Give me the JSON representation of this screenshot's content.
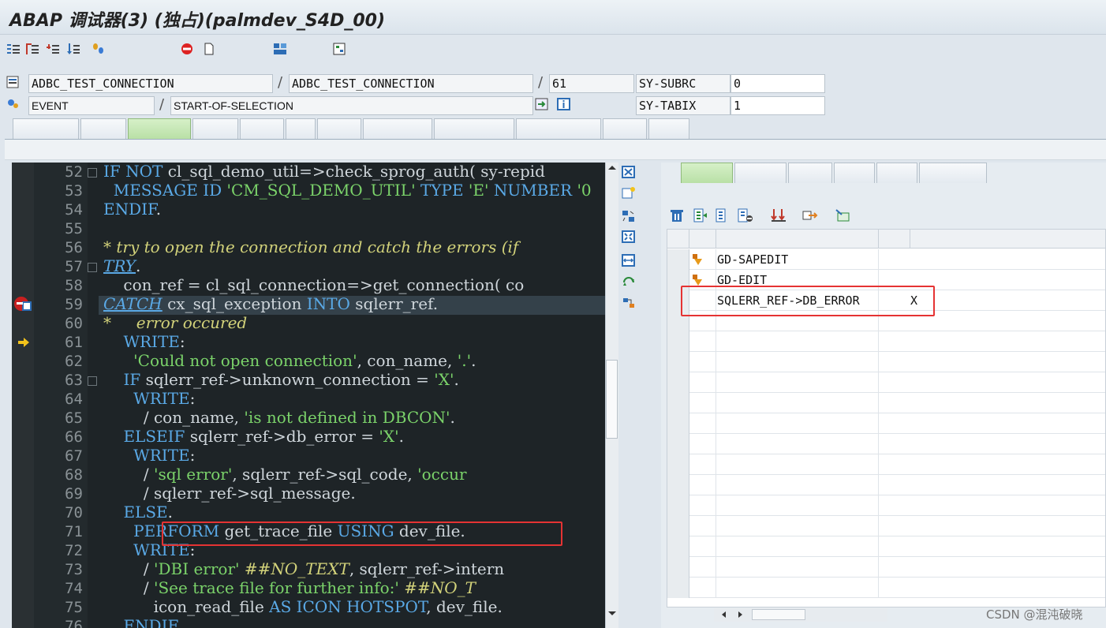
{
  "window": {
    "title": "ABAP 调试器(3) (独占)(palmdev_S4D_00)"
  },
  "toolbar": {
    "step_size_label": "",
    "watchpoint_label": "",
    "layout_label": "",
    "debugger_layer_label": ""
  },
  "context": {
    "program": "ADBC_TEST_CONNECTION",
    "include": "ADBC_TEST_CONNECTION",
    "line": "61",
    "event_type": "EVENT",
    "event_name": "START-OF-SELECTION",
    "sysvars": [
      {
        "name": "SY-SUBRC",
        "value": "0"
      },
      {
        "name": "SY-TABIX",
        "value": "1"
      }
    ]
  },
  "tabs": [
    "",
    "",
    "",
    "",
    "",
    "",
    "",
    "",
    "",
    "",
    "",
    ""
  ],
  "active_tab_index": 2,
  "editor": {
    "lines": [
      {
        "n": "52",
        "html": "<span class=\"kw\">IF NOT</span> cl_sql_demo_util=>check_sprog_auth( sy-repid"
      },
      {
        "n": "53",
        "html": "  <span class=\"kw\">MESSAGE ID</span> <span class=\"str\">'CM_SQL_DEMO_UTIL'</span> <span class=\"kw\">TYPE</span> <span class=\"str\">'E'</span> <span class=\"kw\">NUMBER</span> <span class=\"str\">'0</span>"
      },
      {
        "n": "54",
        "html": "<span class=\"kw\">ENDIF</span>."
      },
      {
        "n": "55",
        "html": ""
      },
      {
        "n": "56",
        "html": "<span class=\"cmt\">* try to open the connection and catch the errors (if</span>"
      },
      {
        "n": "57",
        "html": "<span class=\"kwu\">TRY</span>."
      },
      {
        "n": "58",
        "html": "    con_ref = cl_sql_connection=>get_connection( co"
      },
      {
        "n": "59",
        "html": "<span class=\"kwu\">CATCH</span> cx_sql_exception <span class=\"kw\">INTO</span> sqlerr_ref."
      },
      {
        "n": "60",
        "html": "<span class=\"cmt\">*     error occured</span>"
      },
      {
        "n": "61",
        "html": "    <span class=\"kw\">WRITE</span>:"
      },
      {
        "n": "62",
        "html": "      <span class=\"str\">'Could not open connection'</span>, con_name, <span class=\"str\">'.'</span>."
      },
      {
        "n": "63",
        "html": "    <span class=\"kw\">IF</span> sqlerr_ref->unknown_connection = <span class=\"str\">'X'</span>."
      },
      {
        "n": "64",
        "html": "      <span class=\"kw\">WRITE</span>:"
      },
      {
        "n": "65",
        "html": "        / con_name, <span class=\"str\">'is not defined in DBCON'</span>."
      },
      {
        "n": "66",
        "html": "    <span class=\"kw\">ELSEIF</span> sqlerr_ref->db_error = <span class=\"str\">'X'</span>."
      },
      {
        "n": "67",
        "html": "      <span class=\"kw\">WRITE</span>:"
      },
      {
        "n": "68",
        "html": "        / <span class=\"str\">'sql error'</span>, sqlerr_ref->sql_code, <span class=\"str\">'occur</span>"
      },
      {
        "n": "69",
        "html": "        / sqlerr_ref->sql_message."
      },
      {
        "n": "70",
        "html": "    <span class=\"kw\">ELSE</span>."
      },
      {
        "n": "71",
        "html": "      <span class=\"kw\">PERFORM</span> get_trace_file <span class=\"kw\">USING</span> dev_file."
      },
      {
        "n": "72",
        "html": "      <span class=\"kw\">WRITE</span>:"
      },
      {
        "n": "73",
        "html": "        / <span class=\"str\">'DBI error'</span> <span class=\"cmt\">##NO_TEXT</span>, sqlerr_ref->intern"
      },
      {
        "n": "74",
        "html": "        / <span class=\"str\">'See trace file for further info:'</span> <span class=\"cmt\">##NO_T</span>"
      },
      {
        "n": "75",
        "html": "          icon_read_file <span class=\"kw\">AS ICON HOTSPOT</span>, dev_file."
      },
      {
        "n": "76",
        "html": "    <span class=\"kw\">ENDIF</span>."
      }
    ]
  },
  "variables": {
    "tabs": [
      "",
      "",
      "",
      "",
      "",
      ""
    ],
    "active_tab_index": 0,
    "headers": {
      "status": "",
      "variable": "",
      "val_short": "",
      "value": ""
    },
    "rows": [
      {
        "name": "GD-SAPEDIT",
        "value": ""
      },
      {
        "name": "GD-EDIT",
        "value": ""
      },
      {
        "name": "SQLERR_REF->DB_ERROR",
        "value": "X"
      }
    ]
  },
  "annotations": {
    "note_right_line1": "",
    "note_right_line2": "",
    "note_bottom": ""
  },
  "watermark": "CSDN @混沌破晓",
  "colors": {
    "editor_bg": "#1e2427",
    "keyword": "#5aa9e6",
    "string": "#7bd36a",
    "comment": "#d2d27a",
    "annotation_red": "#e8262a",
    "active_tab": "#b9e0a6"
  },
  "icons": [
    "user-step-icon",
    "watchpoint-icon",
    "stop-icon",
    "layout-icon",
    "debugger-layer-icon",
    "breakpoint-icon",
    "current-line-arrow-icon",
    "delete-icon",
    "variable-icon",
    "changed-icon"
  ]
}
